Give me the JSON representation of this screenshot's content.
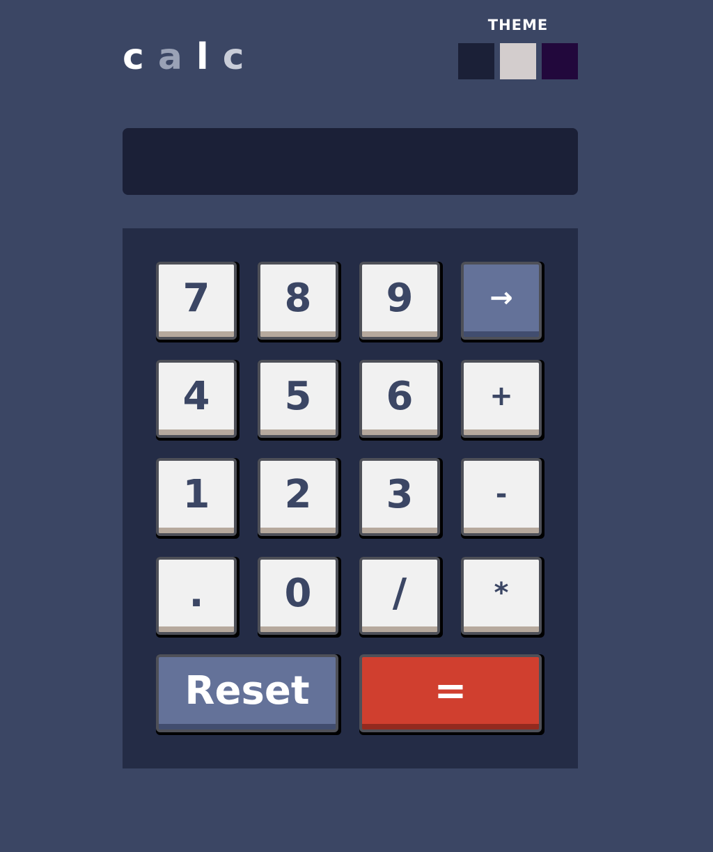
{
  "colors": {
    "background": "#3b4664",
    "screen": "#1b2037",
    "keypad": "#242c46",
    "key_light": "#f1f1f1",
    "key_text": "#3b4664",
    "key_blue": "#647299",
    "key_red": "#d03f2f"
  },
  "header": {
    "logo_letters": [
      {
        "char": "c",
        "color": "#ffffff"
      },
      {
        "char": "a",
        "color": "#9aa2b6"
      },
      {
        "char": "l",
        "color": "#ffffff"
      },
      {
        "char": "c",
        "color": "#c9cdd8"
      }
    ],
    "theme_label": "THEME",
    "theme_swatches": [
      {
        "name": "dark",
        "color": "#1b2037"
      },
      {
        "name": "light",
        "color": "#d3cdcd"
      },
      {
        "name": "purple",
        "color": "#22083c"
      }
    ]
  },
  "screen": {
    "value": ""
  },
  "keys": {
    "k7": "7",
    "k8": "8",
    "k9": "9",
    "backspace": "→",
    "k4": "4",
    "k5": "5",
    "k6": "6",
    "plus": "+",
    "k1": "1",
    "k2": "2",
    "k3": "3",
    "minus": "-",
    "dot": ".",
    "k0": "0",
    "divide": "/",
    "multiply": "*",
    "reset": "Reset",
    "equals": "="
  }
}
